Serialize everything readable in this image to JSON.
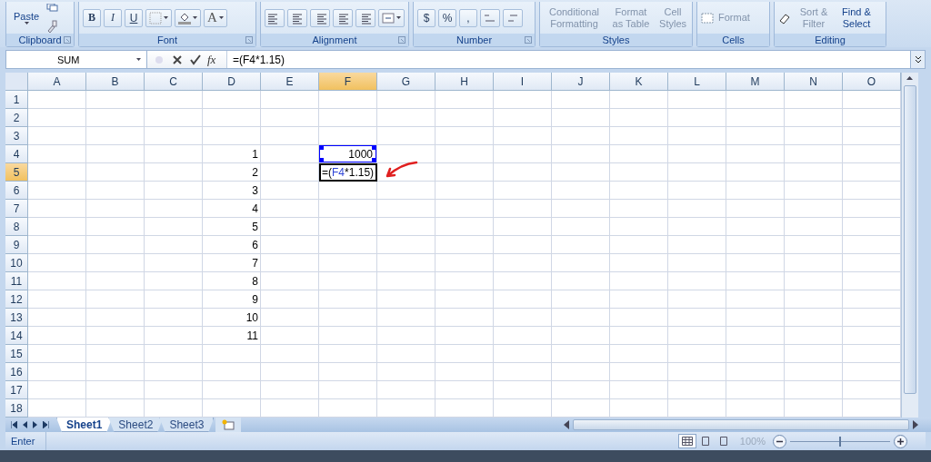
{
  "ribbon": {
    "clipboard": {
      "label": "Clipboard",
      "paste": "Paste"
    },
    "font": {
      "label": "Font",
      "buttons": [
        {
          "label": "B",
          "kind": "bold"
        },
        {
          "label": "I",
          "kind": "italic"
        },
        {
          "label": "U",
          "kind": "underline"
        }
      ],
      "font_color": "A"
    },
    "alignment": {
      "label": "Alignment"
    },
    "number": {
      "label": "Number",
      "buttons": [
        "$",
        "%",
        ","
      ]
    },
    "styles": {
      "label": "Styles",
      "buttons": [
        {
          "label": "Conditional Formatting",
          "disabled": true
        },
        {
          "label": "Format as Table",
          "disabled": true
        },
        {
          "label": "Cell Styles",
          "disabled": true
        }
      ]
    },
    "cells": {
      "label": "Cells",
      "buttons": [
        {
          "label": "Format",
          "disabled": true
        }
      ]
    },
    "editing": {
      "label": "Editing",
      "buttons": [
        {
          "label": "Sort & Filter",
          "disabled": true
        },
        {
          "label": "Find & Select",
          "disabled": false
        }
      ]
    }
  },
  "formula_bar": {
    "name_box": "SUM",
    "function_label": "fx",
    "formula": "=(F4*1.15)"
  },
  "sheet": {
    "columns": [
      {
        "label": "A",
        "selected": false
      },
      {
        "label": "B",
        "selected": false
      },
      {
        "label": "C",
        "selected": false
      },
      {
        "label": "D",
        "selected": false
      },
      {
        "label": "E",
        "selected": false
      },
      {
        "label": "F",
        "selected": true
      },
      {
        "label": "G",
        "selected": false
      },
      {
        "label": "H",
        "selected": false
      },
      {
        "label": "I",
        "selected": false
      },
      {
        "label": "J",
        "selected": false
      },
      {
        "label": "K",
        "selected": false
      },
      {
        "label": "L",
        "selected": false
      },
      {
        "label": "M",
        "selected": false
      },
      {
        "label": "N",
        "selected": false
      },
      {
        "label": "O",
        "selected": false
      }
    ],
    "rows": [
      {
        "label": "1",
        "selected": false
      },
      {
        "label": "2",
        "selected": false
      },
      {
        "label": "3",
        "selected": false
      },
      {
        "label": "4",
        "selected": false,
        "cells": [
          null,
          null,
          null,
          {
            "value": "1"
          },
          null,
          {
            "value": "1000",
            "referenced": true
          }
        ]
      },
      {
        "label": "5",
        "selected": true,
        "cells": [
          null,
          null,
          null,
          {
            "value": "2"
          },
          null,
          {
            "kind": "editing",
            "parts": [
              {
                "text": "=(",
                "ref": false
              },
              {
                "text": "F4",
                "ref": true
              },
              {
                "text": "*1.15)",
                "ref": false
              }
            ]
          }
        ]
      },
      {
        "label": "6",
        "selected": false,
        "cells": [
          null,
          null,
          null,
          {
            "value": "3"
          }
        ]
      },
      {
        "label": "7",
        "selected": false,
        "cells": [
          null,
          null,
          null,
          {
            "value": "4"
          }
        ]
      },
      {
        "label": "8",
        "selected": false,
        "cells": [
          null,
          null,
          null,
          {
            "value": "5"
          }
        ]
      },
      {
        "label": "9",
        "selected": false,
        "cells": [
          null,
          null,
          null,
          {
            "value": "6"
          }
        ]
      },
      {
        "label": "10",
        "selected": false,
        "cells": [
          null,
          null,
          null,
          {
            "value": "7"
          }
        ]
      },
      {
        "label": "11",
        "selected": false,
        "cells": [
          null,
          null,
          null,
          {
            "value": "8"
          }
        ]
      },
      {
        "label": "12",
        "selected": false,
        "cells": [
          null,
          null,
          null,
          {
            "value": "9"
          }
        ]
      },
      {
        "label": "13",
        "selected": false,
        "cells": [
          null,
          null,
          null,
          {
            "value": "10"
          }
        ]
      },
      {
        "label": "14",
        "selected": false,
        "cells": [
          null,
          null,
          null,
          {
            "value": "11"
          }
        ]
      },
      {
        "label": "15",
        "selected": false
      },
      {
        "label": "16",
        "selected": false
      },
      {
        "label": "17",
        "selected": false
      },
      {
        "label": "18",
        "selected": false
      }
    ]
  },
  "sheet_tabs": [
    {
      "label": "Sheet1",
      "selected": true
    },
    {
      "label": "Sheet2",
      "selected": false
    },
    {
      "label": "Sheet3",
      "selected": false
    }
  ],
  "status_bar": {
    "mode": "Enter",
    "views": [
      {
        "kind": "normal",
        "selected": true
      },
      {
        "kind": "layout",
        "selected": false
      },
      {
        "kind": "break",
        "selected": false
      }
    ],
    "zoom": "100%",
    "zoom_slider": {
      "level": 0.5
    }
  }
}
